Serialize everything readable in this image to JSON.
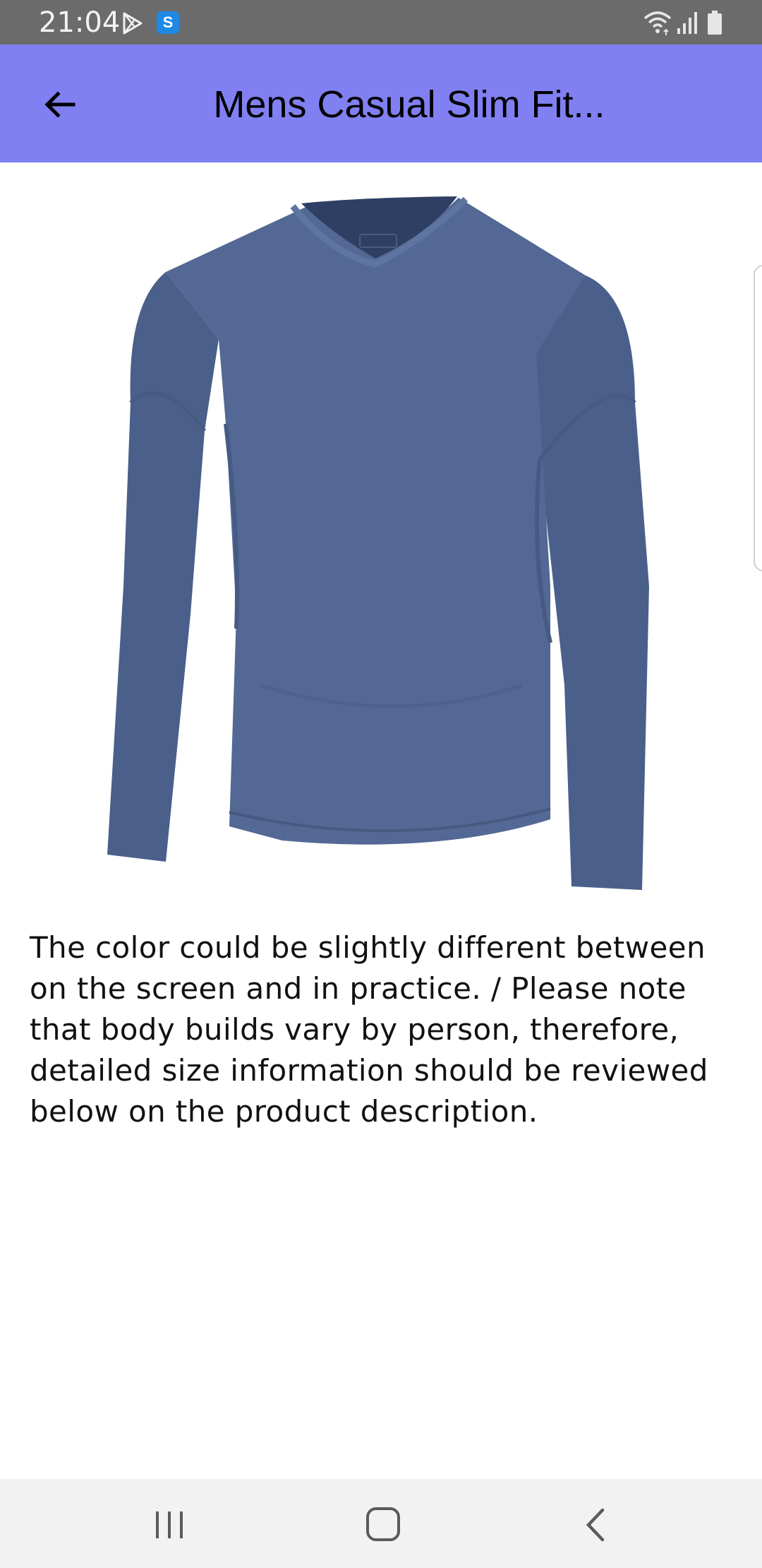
{
  "status_bar": {
    "time": "21:04",
    "icons": [
      "play-store-icon",
      "app-notification-icon",
      "wifi-icon",
      "cell-signal-icon",
      "battery-icon"
    ],
    "app_icon_letter": "S"
  },
  "app_bar": {
    "title": "Mens Casual Slim Fit...",
    "background_color": "#8080f2",
    "back_icon": "arrow-left-icon"
  },
  "product": {
    "image_description": "long-sleeve-v-neck-tshirt",
    "shirt_color": "#4f6490",
    "description": "The color could be slightly different between on the screen and in practice. / Please note that body builds vary by person, therefore, detailed size information should be reviewed below on the product description."
  },
  "nav_bar": {
    "icons": [
      "recents-icon",
      "home-icon",
      "back-chevron-icon"
    ]
  }
}
